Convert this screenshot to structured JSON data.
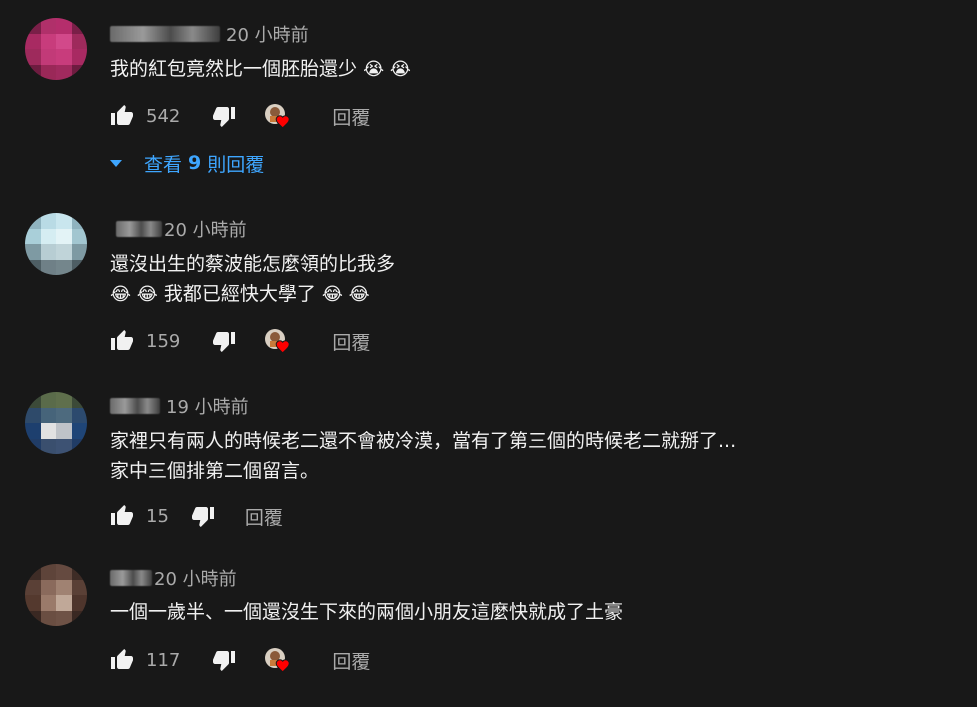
{
  "comments": [
    {
      "time": "20 小時前",
      "lines": [
        "我的紅包竟然比一個胚胎還少"
      ],
      "likes": "542",
      "hearted": true,
      "reply_label": "回覆",
      "emoji": "😭 😭",
      "view_replies": {
        "prefix": "查看",
        "count": "9",
        "suffix": "則回覆"
      }
    },
    {
      "time": "20 小時前",
      "lines": [
        "還沒出生的蔡波能怎麼領的比我多",
        "我都已經快大學了"
      ],
      "emoji_before": "😂 😂",
      "emoji_after": "😂 😂",
      "likes": "159",
      "hearted": true,
      "reply_label": "回覆"
    },
    {
      "time": "19 小時前",
      "lines": [
        "家裡只有兩人的時候老二還不會被冷漠，當有了第三個的時候老二就掰了...",
        "家中三個排第二個留言。"
      ],
      "likes": "15",
      "hearted": false,
      "reply_label": "回覆"
    },
    {
      "time": "20 小時前",
      "lines": [
        "一個一歲半、一個還沒生下來的兩個小朋友這麼快就成了土豪"
      ],
      "likes": "117",
      "hearted": true,
      "reply_label": "回覆"
    }
  ],
  "colors": {
    "background": "#181818",
    "text_primary": "#f1f1f1",
    "text_secondary": "#aaaaaa",
    "link": "#3ea6ff",
    "heart": "#ff0000"
  },
  "icons": {
    "like": "thumb-up-icon",
    "dislike": "thumb-down-icon",
    "creator_heart": "creator-heart-icon",
    "expand": "caret-down-icon"
  }
}
